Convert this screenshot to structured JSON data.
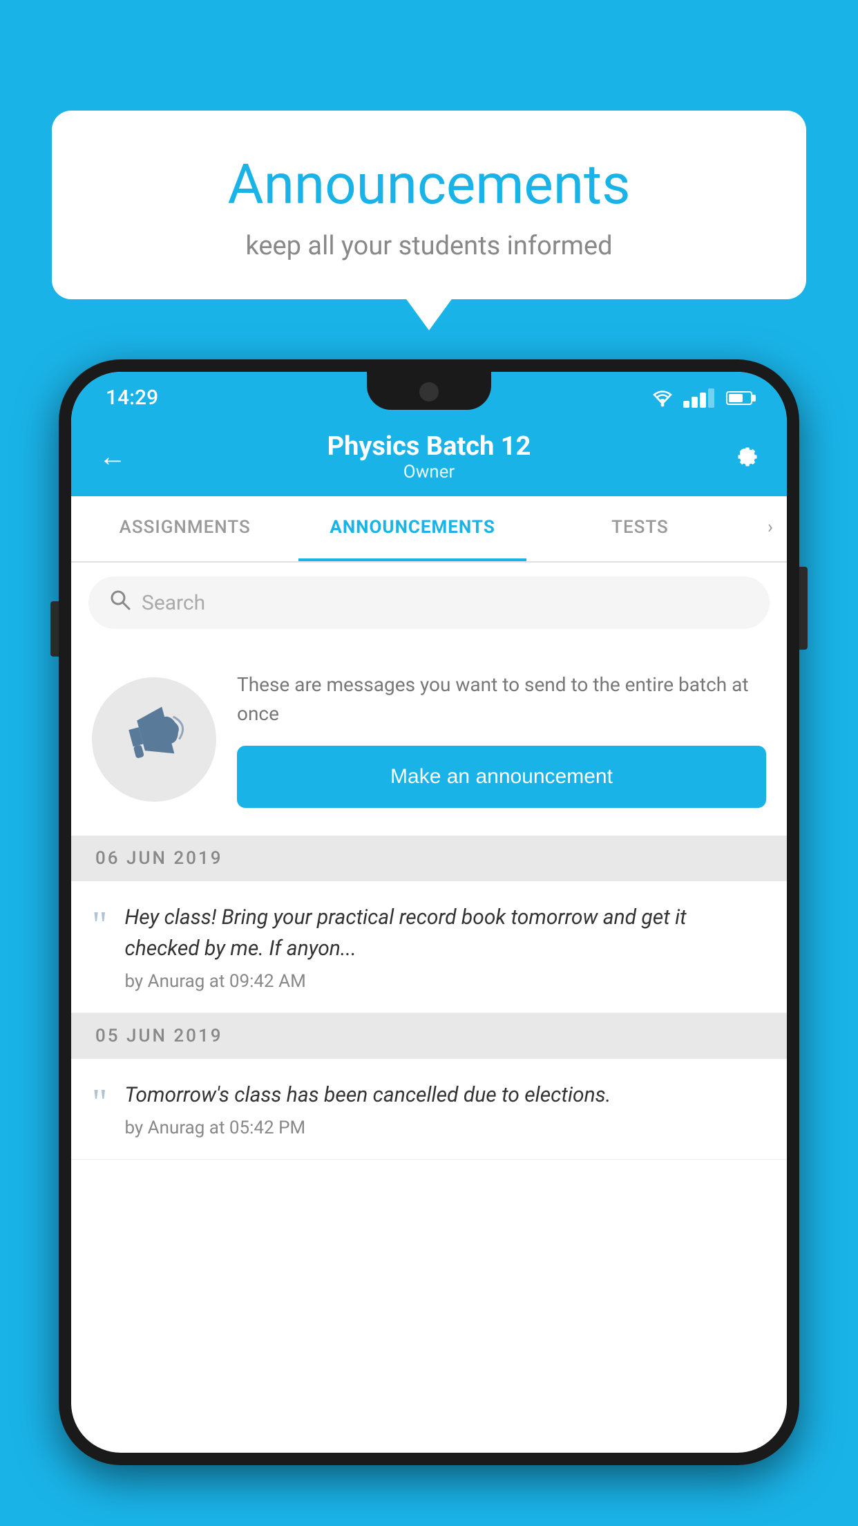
{
  "background_color": "#1ab3e8",
  "speech_bubble": {
    "title": "Announcements",
    "subtitle": "keep all your students informed"
  },
  "phone": {
    "status_bar": {
      "time": "14:29"
    },
    "header": {
      "title": "Physics Batch 12",
      "subtitle": "Owner",
      "back_label": "←",
      "gear_label": "⚙"
    },
    "tabs": [
      {
        "label": "ASSIGNMENTS",
        "active": false
      },
      {
        "label": "ANNOUNCEMENTS",
        "active": true
      },
      {
        "label": "TESTS",
        "active": false
      },
      {
        "label": "›",
        "active": false
      }
    ],
    "search": {
      "placeholder": "Search"
    },
    "promo": {
      "text": "These are messages you want to send to the entire batch at once",
      "button_label": "Make an announcement"
    },
    "announcements": [
      {
        "date": "06  JUN  2019",
        "text": "Hey class! Bring your practical record book tomorrow and get it checked by me. If anyon...",
        "meta": "by Anurag at 09:42 AM"
      },
      {
        "date": "05  JUN  2019",
        "text": "Tomorrow's class has been cancelled due to elections.",
        "meta": "by Anurag at 05:42 PM"
      }
    ]
  }
}
